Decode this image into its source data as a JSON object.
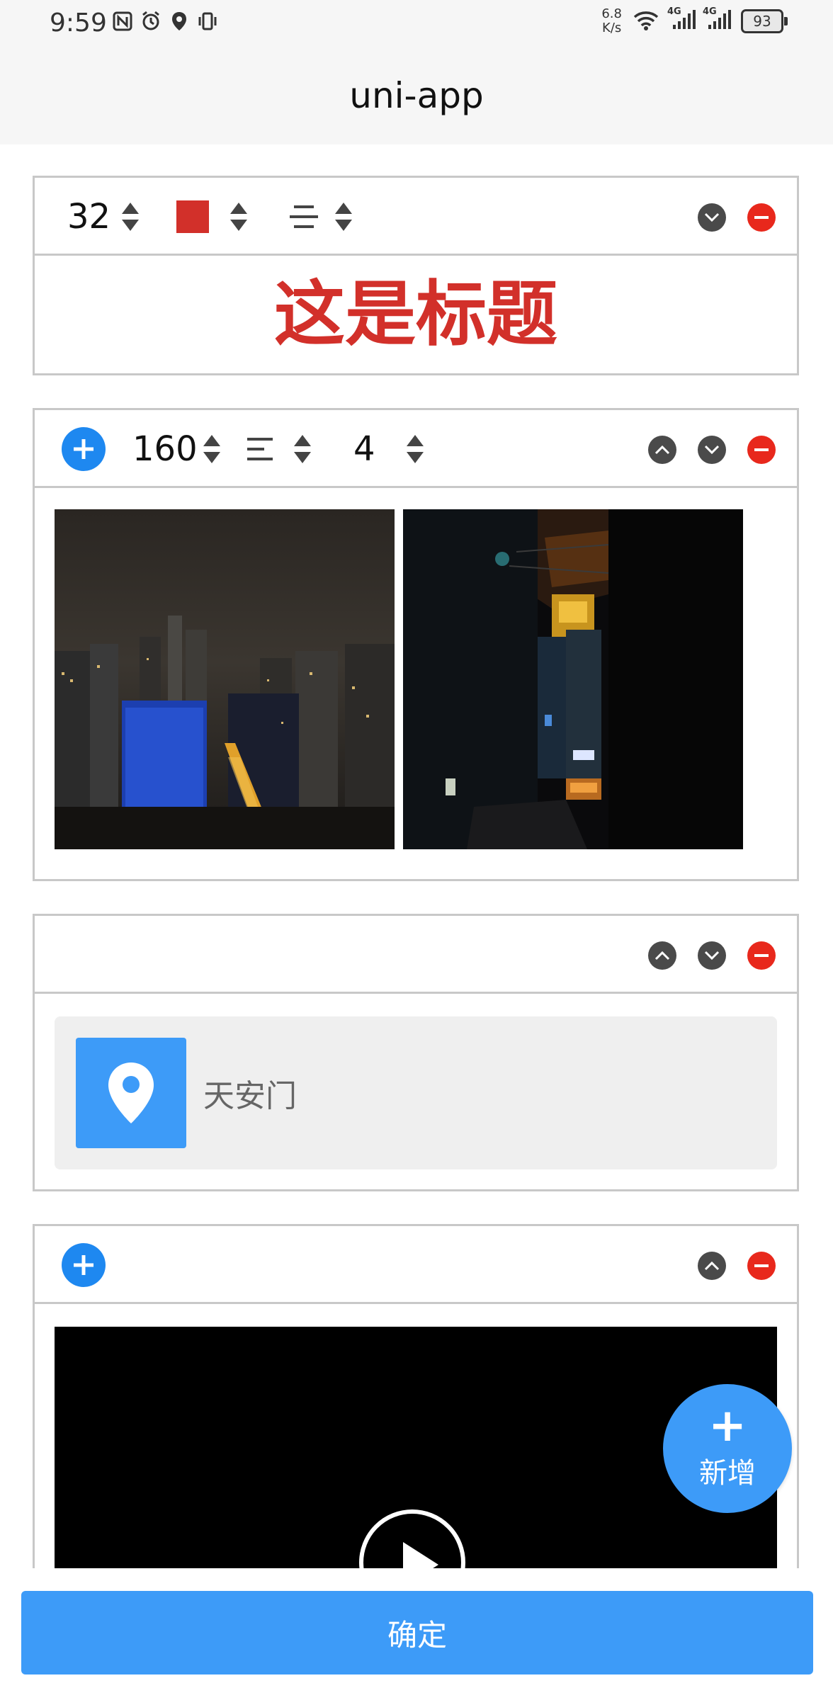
{
  "status_bar": {
    "time": "9:59",
    "net_speed_value": "6.8",
    "net_speed_unit": "K/s",
    "signal_1": "4G",
    "signal_2": "4G",
    "battery": "93",
    "left_icons": [
      "nfc-icon",
      "alarm-icon",
      "location-icon",
      "vibrate-icon"
    ]
  },
  "navbar": {
    "title": "uni-app"
  },
  "blocks": {
    "title_block": {
      "font_size": "32",
      "color": "#d2302a",
      "align": "center",
      "text": "这是标题"
    },
    "image_block": {
      "height": "160",
      "align": "left",
      "columns": "4",
      "images": [
        "night-city-skyline-photo",
        "night-alley-photo"
      ]
    },
    "location_block": {
      "place": "天安门"
    },
    "video_block": {}
  },
  "fab": {
    "plus": "+",
    "label": "新增"
  },
  "footer": {
    "confirm_label": "确定"
  },
  "colors": {
    "accent_blue": "#3d9bf8",
    "plus_blue": "#1e88f0",
    "delete_red": "#e8281c",
    "title_red": "#d2302a",
    "control_gray": "#4a4a4a"
  }
}
